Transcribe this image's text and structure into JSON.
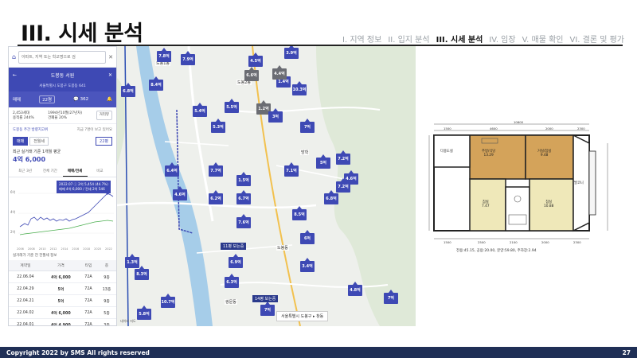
{
  "slide": {
    "title": "III. 시세 분석",
    "nav": [
      {
        "label": "I. 지역 정보",
        "active": false
      },
      {
        "label": "II. 입지 분석",
        "active": false
      },
      {
        "label": "III. 시세 분석",
        "active": true
      },
      {
        "label": "IV. 임장",
        "active": false
      },
      {
        "label": "V. 매물 확인",
        "active": false
      },
      {
        "label": "VI. 결론 및 평가",
        "active": false
      }
    ],
    "footer_copyright": "Copyright 2022 by SMS All rights reserved",
    "page_number": "27"
  },
  "app": {
    "search_placeholder": "아파트, 지역 또는 학교명으로 검",
    "complex_name": "도봉동 서원",
    "address": "서울특별시 도봉구 도봉동 641",
    "deal_label": "매매",
    "size_label": "22평",
    "comment_count": "362",
    "info_left_1": "2,453세대",
    "info_left_2": "용적률 244%",
    "info_mid_1": "1994년10월(27년차)",
    "info_mid_2": "건폐율 20%",
    "info_btn": "거리뷰",
    "notice_left": "도봉동 주간 방향지고위",
    "notice_right": "지금 7명이 보고 있어요",
    "tab_sale": "매매",
    "tab_lease": "전월세",
    "type_pill": "22평",
    "recent_label": "최근 실거래 기준 1개월 평균",
    "avg_price": "4억 6,000",
    "period_tabs": [
      "최근 3년",
      "전체 기간",
      "매매/전세",
      "비교"
    ],
    "tooltip_line1": "2022.07 ⓘ 2억 5,454 (44.7%)",
    "tooltip_line2": "매매 4억 6,000 / 전세 2억 546",
    "axis_top": "6억",
    "axis_mid": "4억",
    "axis_bottom": "2억",
    "years": [
      "2006",
      "2008",
      "2010",
      "2012",
      "2014",
      "2016",
      "2018",
      "2020",
      "2022"
    ],
    "recent_note": "실거래가 기준 전 전월세 정보",
    "table_headers": [
      "계약일",
      "가격",
      "타입",
      "층"
    ],
    "table_rows": [
      [
        "22.06.04",
        "4억 6,000",
        "72A",
        "9층"
      ],
      [
        "22.04.29",
        "5억",
        "72A",
        "13층"
      ],
      [
        "22.04.21",
        "5억",
        "72A",
        "9층"
      ],
      [
        "22.04.02",
        "4억 6,000",
        "72A",
        "5층"
      ],
      [
        "22.04.01",
        "4억 4,900",
        "72A",
        "3층"
      ]
    ]
  },
  "map": {
    "markers": [
      "7.8억",
      "7.9억",
      "4.5억",
      "3.9억",
      "6.8억",
      "6.6억",
      "1.4억",
      "4.4억",
      "8.4억",
      "10.3억",
      "5.4억",
      "5.5억",
      "1.2억",
      "3억",
      "5.3억",
      "7억",
      "6.4억",
      "7.2억",
      "5억",
      "7.7억",
      "1.5억",
      "7.1억",
      "4.6억",
      "6.7억",
      "6.2억",
      "4.6억",
      "7.2억",
      "6.8억",
      "7.6억",
      "8.5억",
      "6억",
      "1.3억",
      "6.9억",
      "3.4억",
      "6.3억",
      "8.3억",
      "7억",
      "10.7억",
      "4.8억",
      "7억",
      "5.8억"
    ],
    "labels": [
      "도봉1동",
      "도봉2동",
      "방학",
      "창동",
      "도봉동",
      "쌍문동"
    ],
    "tags": [
      "11평 보는중",
      "14평 보는중"
    ],
    "footer_text": "서울특별시 도봉구 ▸ 창동",
    "credit": "네이버 지도"
  },
  "plan": {
    "rooms": [
      {
        "name": "주방/식당",
        "area": "13.29"
      },
      {
        "name": "거실/침실",
        "area": "9.48"
      },
      {
        "name": "침실",
        "area": "7.47"
      },
      {
        "name": "침실",
        "area": "10.88"
      },
      {
        "name": "다용도실",
        "area": ""
      },
      {
        "name": "발코니",
        "area": ""
      }
    ],
    "dims_top": [
      "10600"
    ],
    "dims_sub": [
      "1500",
      "4600",
      "2000",
      "2300"
    ],
    "dims_bottom": [
      "1500",
      "2500",
      "2100",
      "2000",
      "2300"
    ],
    "caption": "전용:45.15, 공용:20.00, 분양:59.80, 주차장:2.94"
  }
}
